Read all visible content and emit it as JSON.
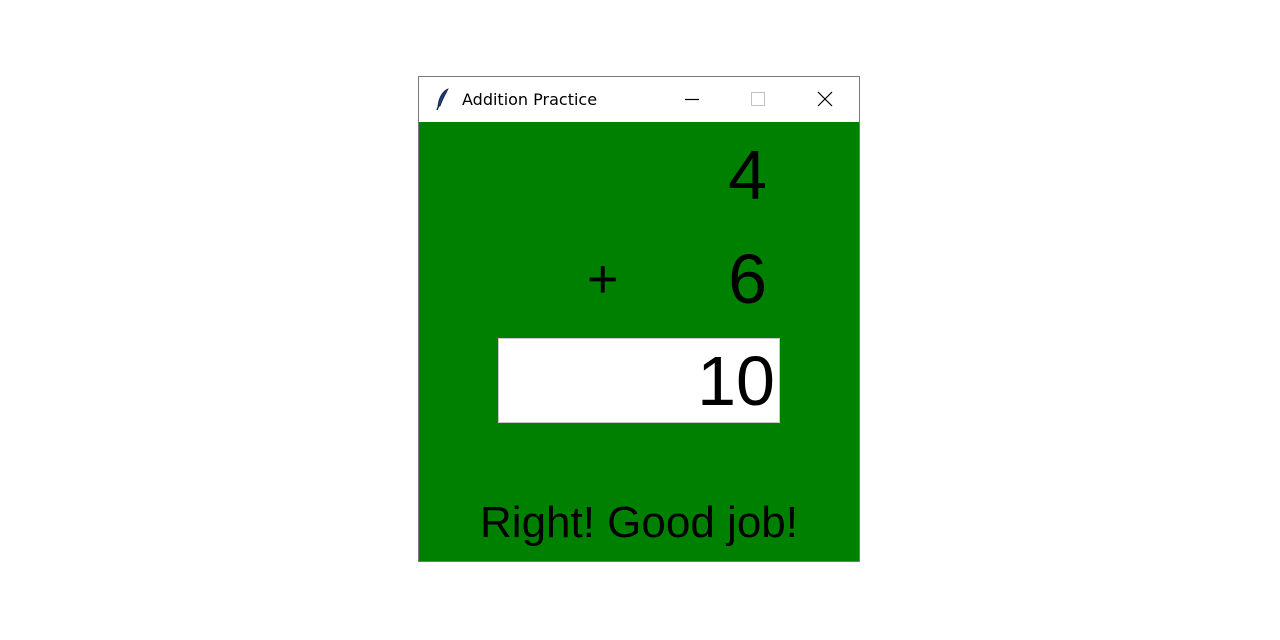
{
  "window": {
    "title": "Addition Practice",
    "icons": {
      "app": "feather-icon",
      "minimize": "minimize-icon",
      "maximize": "maximize-icon",
      "close": "close-icon"
    }
  },
  "problem": {
    "first_number": "4",
    "operator": "+",
    "second_number": "6"
  },
  "answer": {
    "value": "10"
  },
  "feedback": {
    "message": "Right! Good job!"
  },
  "colors": {
    "background": "#008000",
    "text": "#000000",
    "input_background": "#ffffff"
  }
}
